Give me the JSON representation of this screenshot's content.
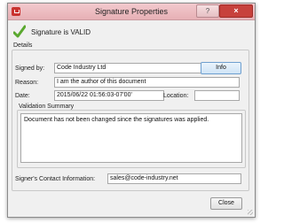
{
  "window": {
    "title": "Signature Properties",
    "help_label": "?",
    "close_label": "×"
  },
  "status": {
    "message": "Signature is VALID",
    "icon": "checkmark-icon",
    "color": "#5aa82f"
  },
  "details": {
    "group_label": "Details",
    "signed_by_label": "Signed by:",
    "signed_by_value": "Code Industry Ltd",
    "info_button": "Info",
    "reason_label": "Reason:",
    "reason_value": "I am the author of this document",
    "date_label": "Date:",
    "date_value": "2015/06/22 01:56:03-07'00'",
    "location_label": "Location:",
    "location_value": ""
  },
  "validation": {
    "group_label": "Validation Summary",
    "text": "Document has not been changed since the signatures was applied."
  },
  "contact": {
    "label": "Signer's Contact Information:",
    "value": "sales@code-industry.net"
  },
  "footer": {
    "close_button": "Close"
  }
}
